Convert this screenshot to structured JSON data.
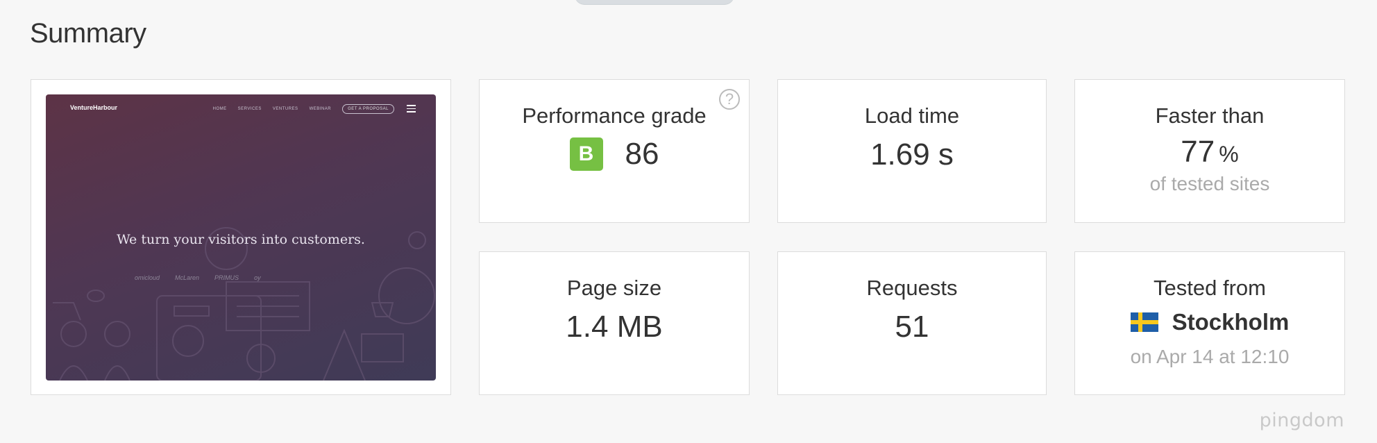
{
  "section": {
    "title": "Summary"
  },
  "preview": {
    "logo": "VentureHarbour",
    "nav": [
      "HOME",
      "SERVICES",
      "VENTURES",
      "WEBINAR"
    ],
    "cta": "GET A PROPOSAL",
    "headline": "We turn your visitors into customers.",
    "clients": [
      "omicloud",
      "McLaren",
      "PRIMUS",
      "oy"
    ]
  },
  "performance": {
    "label": "Performance grade",
    "grade": "B",
    "score": "86",
    "help_icon": "question-circle-icon",
    "grade_color": "#76c043"
  },
  "load_time": {
    "label": "Load time",
    "value": "1.69 s"
  },
  "faster_than": {
    "label": "Faster than",
    "value": "77",
    "unit": "%",
    "sub": "of tested sites"
  },
  "page_size": {
    "label": "Page size",
    "value": "1.4 MB"
  },
  "requests": {
    "label": "Requests",
    "value": "51"
  },
  "tested_from": {
    "label": "Tested from",
    "location": "Stockholm",
    "flag_icon": "sweden-flag-icon",
    "sub": "on Apr 14 at 12:10"
  },
  "branding": {
    "watermark": "pingdom"
  }
}
